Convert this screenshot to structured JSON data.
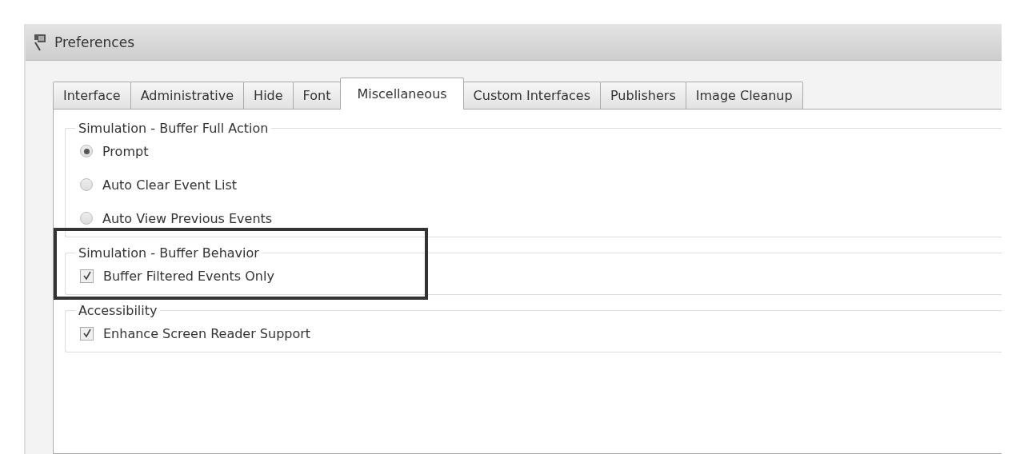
{
  "window": {
    "title": "Preferences"
  },
  "tabs": [
    {
      "label": "Interface",
      "selected": false
    },
    {
      "label": "Administrative",
      "selected": false
    },
    {
      "label": "Hide",
      "selected": false
    },
    {
      "label": "Font",
      "selected": false
    },
    {
      "label": "Miscellaneous",
      "selected": true
    },
    {
      "label": "Custom Interfaces",
      "selected": false
    },
    {
      "label": "Publishers",
      "selected": false
    },
    {
      "label": "Image Cleanup",
      "selected": false
    }
  ],
  "groups": [
    {
      "title": "Simulation - Buffer Full Action",
      "highlighted": false,
      "items": [
        {
          "kind": "radio",
          "label": "Prompt",
          "selected": true
        },
        {
          "kind": "radio",
          "label": "Auto Clear Event List",
          "selected": false
        },
        {
          "kind": "radio",
          "label": "Auto View Previous Events",
          "selected": false
        }
      ]
    },
    {
      "title": "Simulation - Buffer Behavior",
      "highlighted": true,
      "items": [
        {
          "kind": "checkbox",
          "label": "Buffer Filtered Events Only",
          "checked": true
        }
      ]
    },
    {
      "title": "Accessibility",
      "highlighted": false,
      "items": [
        {
          "kind": "checkbox",
          "label": "Enhance Screen Reader Support",
          "checked": true
        }
      ]
    }
  ]
}
